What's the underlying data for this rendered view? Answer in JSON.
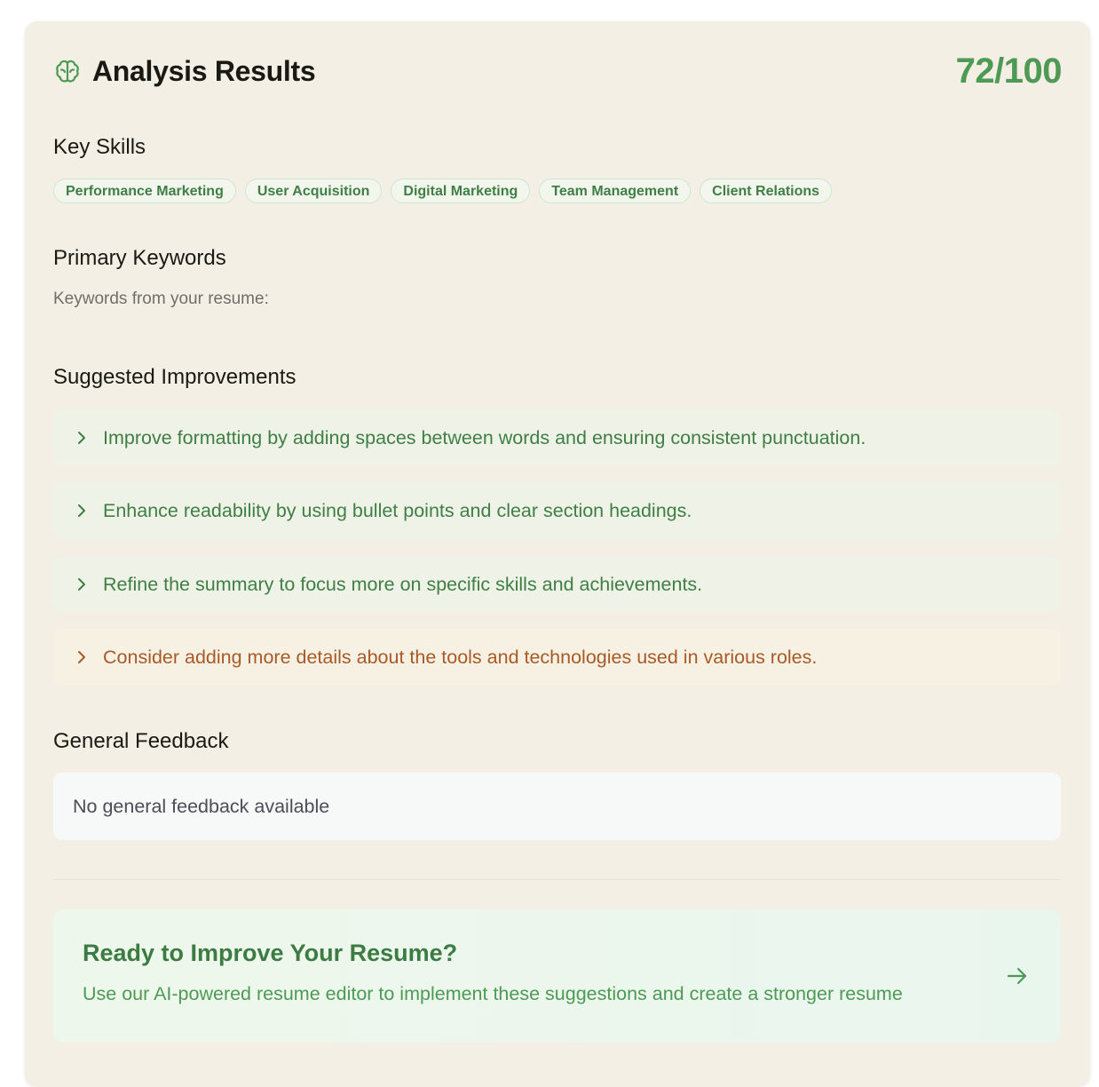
{
  "header": {
    "title": "Analysis Results",
    "score": "72/100",
    "icon": "brain-icon"
  },
  "sections": {
    "key_skills": "Key Skills",
    "primary_keywords": "Primary Keywords",
    "suggested_improvements": "Suggested Improvements",
    "general_feedback": "General Feedback"
  },
  "skills": [
    "Performance Marketing",
    "User Acquisition",
    "Digital Marketing",
    "Team Management",
    "Client Relations"
  ],
  "keywords": {
    "intro": "Keywords from your resume:"
  },
  "improvements": [
    {
      "text": "Improve formatting by adding spaces between words and ensuring consistent punctuation.",
      "level": "normal"
    },
    {
      "text": "Enhance readability by using bullet points and clear section headings.",
      "level": "normal"
    },
    {
      "text": "Refine the summary to focus more on specific skills and achievements.",
      "level": "normal"
    },
    {
      "text": "Consider adding more details about the tools and technologies used in various roles.",
      "level": "warning"
    }
  ],
  "feedback": {
    "text": "No general feedback available"
  },
  "cta": {
    "title": "Ready to Improve Your Resume?",
    "description": "Use our AI-powered resume editor to implement these suggestions and create a stronger resume",
    "icon": "arrow-right-icon"
  },
  "colors": {
    "accent": "#4e9a54",
    "warning": "#a85a28",
    "card_bg": "#f3efe4"
  }
}
